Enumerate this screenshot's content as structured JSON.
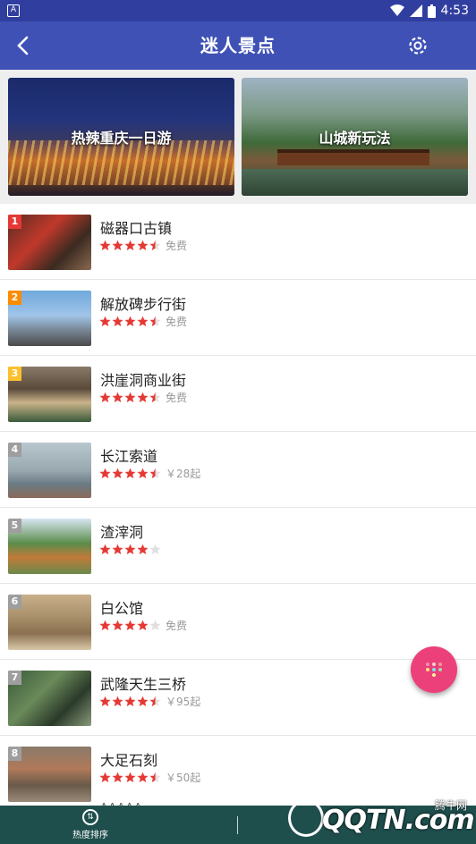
{
  "status_bar": {
    "time": "4:53",
    "notif_glyph": "A"
  },
  "app_bar": {
    "title": "迷人景点",
    "back_icon": "back-arrow-icon",
    "settings_icon": "gear-icon"
  },
  "banners": [
    {
      "label": "热辣重庆一日游"
    },
    {
      "label": "山城新玩法"
    }
  ],
  "spots": [
    {
      "rank": "1",
      "name": "磁器口古镇",
      "rating": 4.5,
      "price": "免费",
      "badge_color": "#e53935"
    },
    {
      "rank": "2",
      "name": "解放碑步行街",
      "rating": 4.5,
      "price": "免费",
      "badge_color": "#fb8c00"
    },
    {
      "rank": "3",
      "name": "洪崖洞商业街",
      "rating": 4.5,
      "price": "免费",
      "badge_color": "#fbc02d"
    },
    {
      "rank": "4",
      "name": "长江索道",
      "rating": 4.5,
      "price": "￥28起",
      "badge_color": "#9e9e9e"
    },
    {
      "rank": "5",
      "name": "渣滓洞",
      "rating": 4,
      "price": "",
      "badge_color": "#9e9e9e"
    },
    {
      "rank": "6",
      "name": "白公馆",
      "rating": 4,
      "price": "免费",
      "badge_color": "#9e9e9e"
    },
    {
      "rank": "7",
      "name": "武隆天生三桥",
      "rating": 4.5,
      "price": "￥95起",
      "badge_color": "#9e9e9e"
    },
    {
      "rank": "8",
      "name": "大足石刻",
      "rating": 4.5,
      "price": "￥50起",
      "badge_color": "#9e9e9e"
    }
  ],
  "peek_text": "AAAAA",
  "bottom_bar": {
    "sort_label": "热度排序"
  },
  "watermark": {
    "brand": "QQTN.com",
    "cn": "腾牛网"
  },
  "colors": {
    "status": "#303f9f",
    "appbar": "#3f51b5",
    "star": "#e53935",
    "fab": "#ec407a",
    "bottom": "#1f4f4d"
  }
}
